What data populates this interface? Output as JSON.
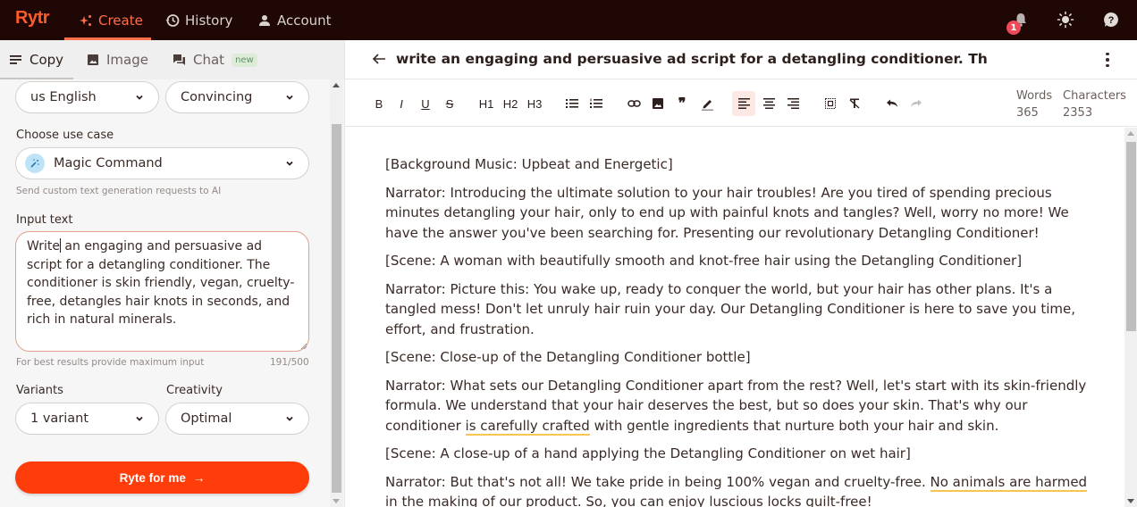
{
  "app": {
    "logo": "Rytr"
  },
  "nav": {
    "items": [
      {
        "label": "Create",
        "icon": "sparkle-icon",
        "active": true
      },
      {
        "label": "History",
        "icon": "history-icon",
        "active": false
      },
      {
        "label": "Account",
        "icon": "user-icon",
        "active": false
      }
    ],
    "notification_count": "1"
  },
  "left_tabs": [
    {
      "label": "Copy",
      "icon": "lines-icon",
      "active": true
    },
    {
      "label": "Image",
      "icon": "image-icon",
      "active": false
    },
    {
      "label": "Chat",
      "icon": "chat-icon",
      "active": false,
      "badge": "new"
    }
  ],
  "form": {
    "language": "us English",
    "tone": "Convincing",
    "use_case_label": "Choose use case",
    "use_case": "Magic Command",
    "use_case_hint": "Send custom text generation requests to AI",
    "input_label": "Input text",
    "input_before_caret": "Write",
    "input_after_caret": " an engaging and persuasive ad script for a detangling conditioner. The conditioner is skin friendly, vegan, cruelty-free, detangles hair knots in seconds, and rich in natural minerals.",
    "input_hint": "For best results provide maximum input",
    "input_count": "191/500",
    "variants_label": "Variants",
    "variants": "1 variant",
    "creativity_label": "Creativity",
    "creativity": "Optimal",
    "submit_label": "Ryte for me",
    "submit_arrow": "→"
  },
  "document": {
    "title": "write an engaging and persuasive ad script for a detangling conditioner. Th",
    "toolbar": {
      "bold": "B",
      "italic": "I",
      "underline": "U",
      "strike": "S",
      "h1": "H1",
      "h2": "H2",
      "h3": "H3"
    },
    "stats": {
      "words_label": "Words",
      "words": "365",
      "chars_label": "Characters",
      "chars": "2353"
    },
    "paragraphs": [
      {
        "text": "[Background Music: Upbeat and Energetic]"
      },
      {
        "text": "Narrator: Introducing the ultimate solution to your hair troubles! Are you tired of spending precious minutes detangling your hair, only to end up with painful knots and tangles? Well, worry no more! We have the answer you've been searching for. Presenting our revolutionary Detangling Conditioner!"
      },
      {
        "text": "[Scene: A woman with beautifully smooth and knot-free hair using the Detangling Conditioner]"
      },
      {
        "text": "Narrator: Picture this: You wake up, ready to conquer the world, but your hair has other plans. It's a tangled mess! Don't let unruly hair ruin your day. Our Detangling Conditioner is here to save you time, effort, and frustration."
      },
      {
        "text": "[Scene: Close-up of the Detangling Conditioner bottle]"
      },
      {
        "before": "Narrator: What sets our Detangling Conditioner apart from the rest? Well, let's start with its skin-friendly formula. We understand that your hair deserves the best, but so does your skin. That's why our conditioner ",
        "flagged": "is carefully crafted",
        "after": " with gentle ingredients that nurture both your hair and skin."
      },
      {
        "text": "[Scene: A close-up of a hand applying the Detangling Conditioner on wet hair]"
      },
      {
        "before": "Narrator: But that's not all! We take pride in being 100% vegan and cruelty-free. ",
        "flagged": "No animals are harmed",
        "after": " in the making of our product. So, you can enjoy luscious locks guilt-free!"
      }
    ]
  },
  "colors": {
    "brand": "#ff3d0a",
    "nav_bg": "#1f0705",
    "accent": "#ff6f4a",
    "highlight": "#f7c650"
  }
}
